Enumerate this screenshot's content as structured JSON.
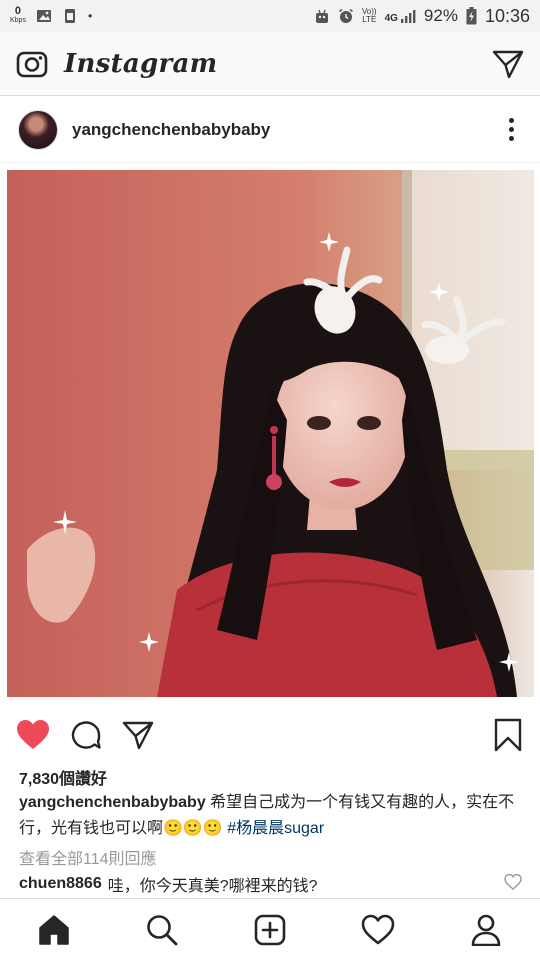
{
  "status_bar": {
    "kbps_value": "0",
    "kbps_unit": "Kbps",
    "dot": "•",
    "volte_top": "Vo))",
    "volte_bottom": "LTE",
    "network": "4G",
    "battery_percent": "92%",
    "time": "10:36"
  },
  "app": {
    "title": "Instagram"
  },
  "post": {
    "username": "yangchenchenbabybaby",
    "likes": "7,830個讚好",
    "caption_user": "yangchenchenbabybaby",
    "caption_text": " 希望自己成为一个有钱又有趣的人，实在不行，光有钱也可以啊🙂🙂🙂 ",
    "hashtag": "#杨晨晨sugar",
    "view_all_comments": "查看全部114則回應",
    "comment_user": "chuen8866",
    "comment_text": "哇，你今天真美?哪裡来的钱?"
  },
  "colors": {
    "like_red": "#ed4956",
    "hashtag_blue": "#003569",
    "secondary_text": "#999999"
  },
  "icons": {
    "camera": "camera-icon",
    "direct": "paper-plane-icon",
    "like": "heart-filled-icon",
    "comment": "comment-bubble-icon",
    "share": "paper-plane-icon",
    "save": "bookmark-icon",
    "home": "home-icon",
    "search": "search-icon",
    "add": "plus-square-icon",
    "activity": "heart-outline-icon",
    "profile": "person-icon"
  }
}
